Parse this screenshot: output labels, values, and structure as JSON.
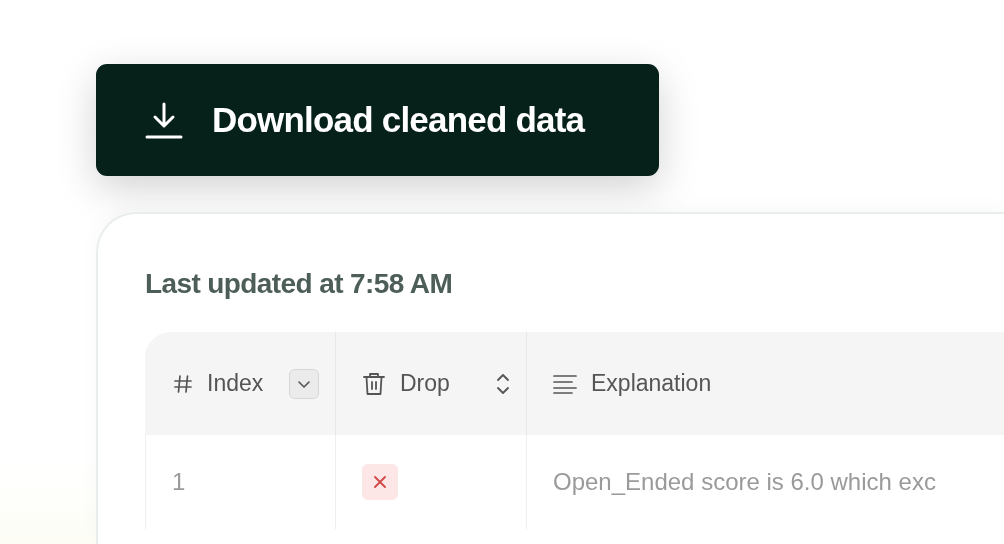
{
  "download_button": {
    "label": "Download cleaned data"
  },
  "card": {
    "title": "Last updated at 7:58 AM",
    "table": {
      "columns": [
        {
          "label": "Index",
          "kind": "sorted"
        },
        {
          "label": "Drop",
          "kind": "sortable"
        },
        {
          "label": "Explanation",
          "kind": "plain"
        }
      ],
      "rows": [
        {
          "index": "1",
          "drop": true,
          "explanation": "Open_Ended score is 6.0 which exc"
        }
      ]
    }
  }
}
